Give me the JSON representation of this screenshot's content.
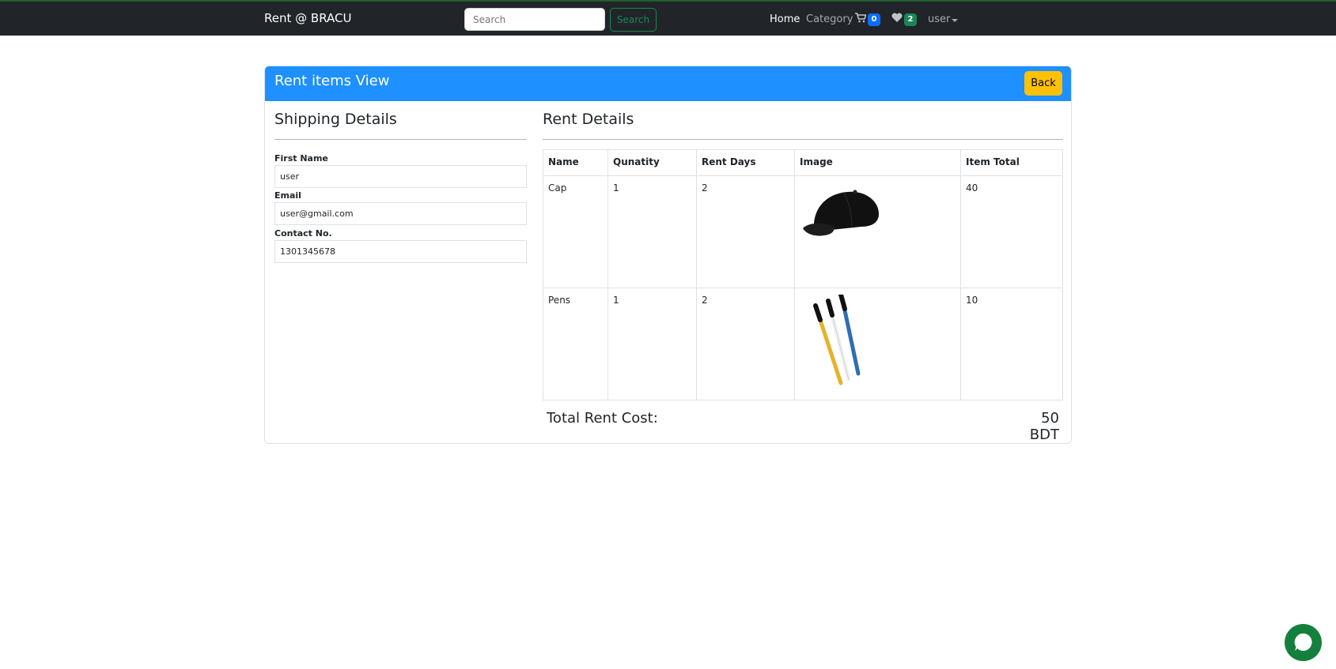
{
  "navbar": {
    "brand": "Rent @ BRACU",
    "search_placeholder": "Search",
    "search_button": "Search",
    "links": {
      "home": "Home",
      "category": "Category"
    },
    "cart_count": "0",
    "wishlist_count": "2",
    "user_menu": "user"
  },
  "card": {
    "title": "Rent items View",
    "back_button": "Back"
  },
  "shipping": {
    "heading": "Shipping Details",
    "first_name_label": "First Name",
    "first_name": "user",
    "email_label": "Email",
    "email": "user@gmail.com",
    "contact_label": "Contact No.",
    "contact": "1301345678"
  },
  "rent_details": {
    "heading": "Rent Details",
    "columns": [
      "Name",
      "Qunatity",
      "Rent Days",
      "Image",
      "Item Total"
    ],
    "rows": [
      {
        "name": "Cap",
        "quantity": "1",
        "rent_days": "2",
        "image": "black-cap",
        "item_total": "40"
      },
      {
        "name": "Pens",
        "quantity": "1",
        "rent_days": "2",
        "image": "ballpoint-pens",
        "item_total": "10"
      }
    ],
    "total_label": "Total Rent Cost:",
    "total_value": "50 BDT"
  },
  "colors": {
    "navbar_bg": "#212529",
    "header_blue": "#1e90ff",
    "back_button": "#ffc107",
    "search_green": "#198754",
    "cart_badge": "#0d6efd",
    "wishlist_badge": "#198754",
    "chat_green": "#15803d"
  },
  "icons": {
    "cart": "cart-icon",
    "wishlist": "heart-icon",
    "chat": "chat-bubble-icon"
  }
}
